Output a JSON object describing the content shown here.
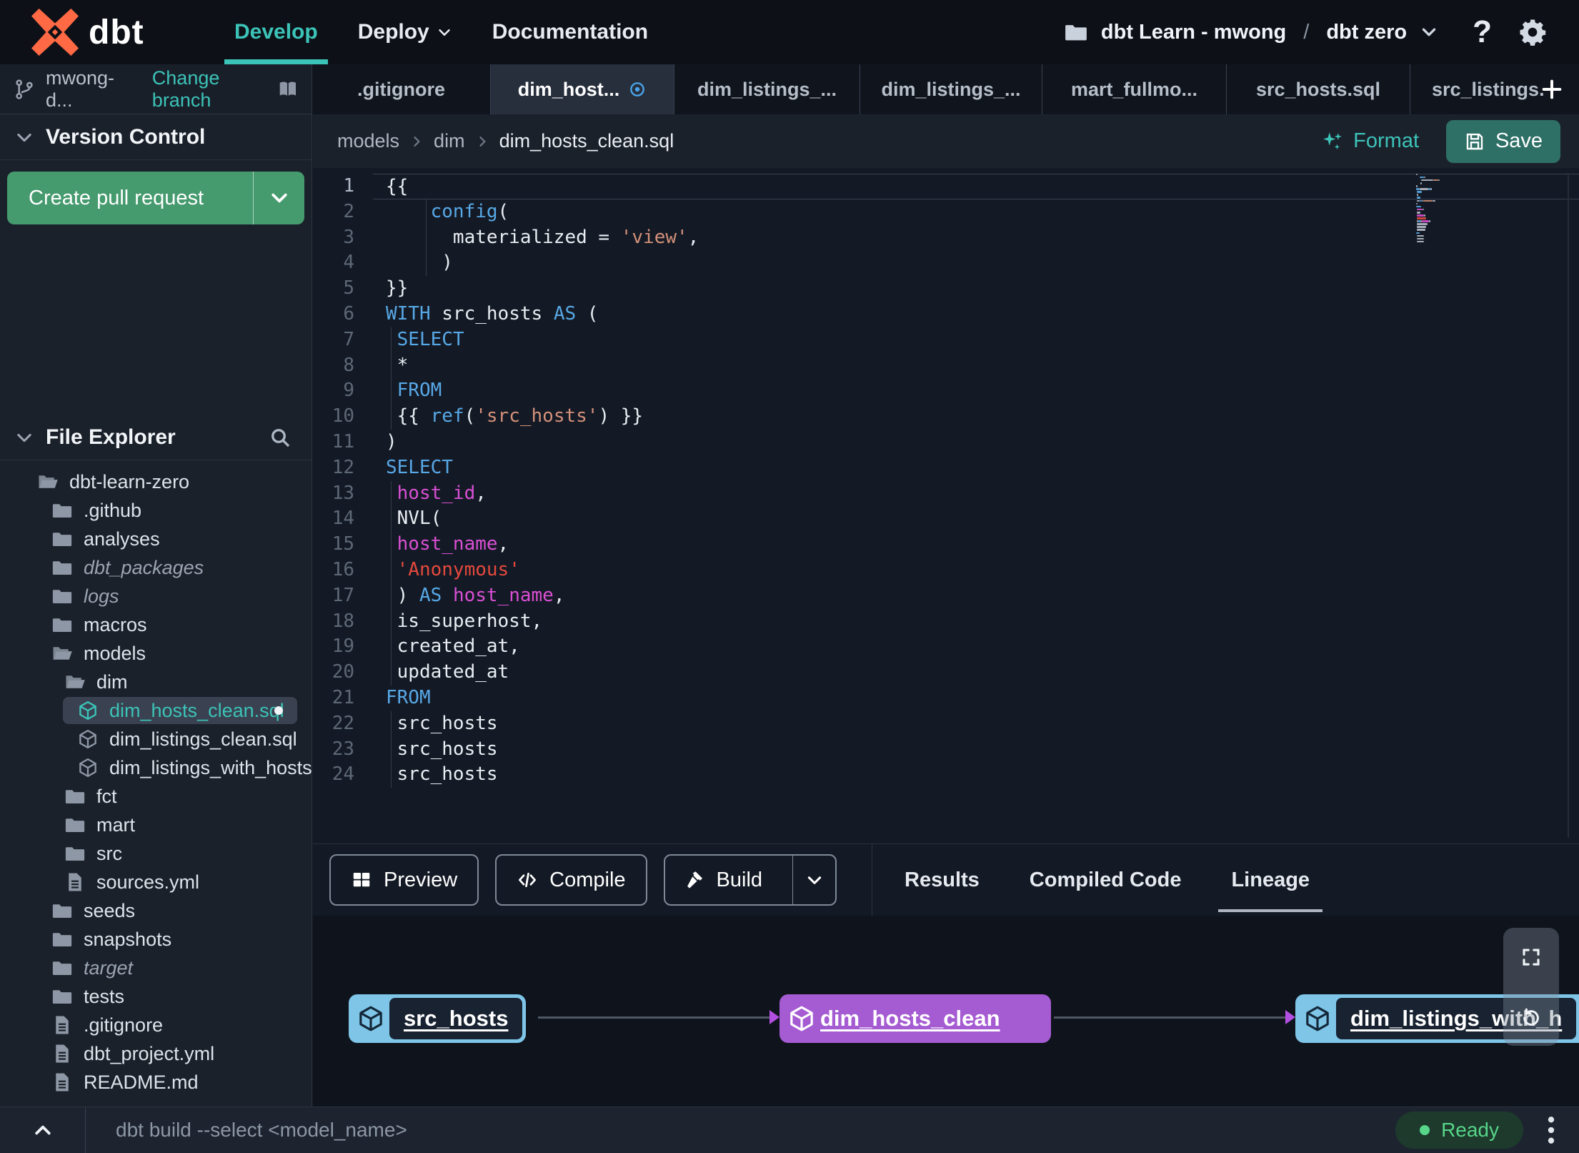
{
  "topbar": {
    "brand": "dbt",
    "nav": [
      {
        "label": "Develop",
        "active": true
      },
      {
        "label": "Deploy",
        "has_chevron": true
      },
      {
        "label": "Documentation"
      }
    ],
    "project_selector": {
      "account": "dbt Learn - mwong",
      "separator": "/",
      "project": "dbt zero"
    },
    "help_label": "?"
  },
  "branch_bar": {
    "branch": "mwong-d...",
    "change_branch": "Change branch"
  },
  "editor_tabs": [
    {
      "label": ".gitignore"
    },
    {
      "label": "dim_host...",
      "active": true,
      "modified": true
    },
    {
      "label": "dim_listings_..."
    },
    {
      "label": "dim_listings_..."
    },
    {
      "label": "mart_fullmo..."
    },
    {
      "label": "src_hosts.sql"
    },
    {
      "label": "src_listings.",
      "last": true
    }
  ],
  "sidebar": {
    "version_control": {
      "title": "Version Control",
      "create_pr": "Create pull request"
    },
    "file_explorer": {
      "title": "File Explorer",
      "items": [
        {
          "label": "dbt-learn-zero",
          "icon": "folder-open",
          "indent": 0
        },
        {
          "label": ".github",
          "icon": "folder",
          "indent": 1
        },
        {
          "label": "analyses",
          "icon": "folder",
          "indent": 1
        },
        {
          "label": "dbt_packages",
          "icon": "folder",
          "indent": 1,
          "italic": true
        },
        {
          "label": "logs",
          "icon": "folder",
          "indent": 1,
          "italic": true
        },
        {
          "label": "macros",
          "icon": "folder",
          "indent": 1
        },
        {
          "label": "models",
          "icon": "folder-open",
          "indent": 1
        },
        {
          "label": "dim",
          "icon": "folder-open",
          "indent": 2
        },
        {
          "label": "dim_hosts_clean.sql",
          "icon": "model",
          "indent": 3,
          "selected": true,
          "modified": true
        },
        {
          "label": "dim_listings_clean.sql",
          "icon": "model",
          "indent": 3
        },
        {
          "label": "dim_listings_with_hosts...",
          "icon": "model",
          "indent": 3
        },
        {
          "label": "fct",
          "icon": "folder",
          "indent": 2
        },
        {
          "label": "mart",
          "icon": "folder",
          "indent": 2
        },
        {
          "label": "src",
          "icon": "folder",
          "indent": 2
        },
        {
          "label": "sources.yml",
          "icon": "file",
          "indent": 2
        },
        {
          "label": "seeds",
          "icon": "folder",
          "indent": 1
        },
        {
          "label": "snapshots",
          "icon": "folder",
          "indent": 1
        },
        {
          "label": "target",
          "icon": "folder",
          "indent": 1,
          "italic": true
        },
        {
          "label": "tests",
          "icon": "folder",
          "indent": 1
        },
        {
          "label": ".gitignore",
          "icon": "file",
          "indent": 1
        },
        {
          "label": "dbt_project.yml",
          "icon": "file",
          "indent": 1
        },
        {
          "label": "README.md",
          "icon": "file",
          "indent": 1
        }
      ]
    }
  },
  "editor": {
    "breadcrumb": [
      "models",
      "dim",
      "dim_hosts_clean.sql"
    ],
    "format_label": "Format",
    "save_label": "Save",
    "code_lines": [
      {
        "n": 1,
        "cur": true,
        "segs": [
          [
            "{{",
            "p"
          ]
        ]
      },
      {
        "n": 2,
        "g": [
          3.6
        ],
        "segs": [
          [
            "    ",
            "p"
          ],
          [
            "config",
            "kw"
          ],
          [
            "(",
            "p"
          ]
        ]
      },
      {
        "n": 3,
        "g": [
          3.6
        ],
        "segs": [
          [
            "      materialized = ",
            "p"
          ],
          [
            "'view'",
            "str"
          ],
          [
            ",",
            "p"
          ]
        ]
      },
      {
        "n": 4,
        "g": [
          3.6
        ],
        "segs": [
          [
            "     )",
            "p"
          ]
        ]
      },
      {
        "n": 5,
        "segs": [
          [
            "}}",
            "p"
          ]
        ]
      },
      {
        "n": 6,
        "segs": [
          [
            "WITH",
            "kw"
          ],
          [
            " src_hosts ",
            "p"
          ],
          [
            "AS",
            "kw"
          ],
          [
            " (",
            "p"
          ]
        ]
      },
      {
        "n": 7,
        "g": [
          0.45
        ],
        "segs": [
          [
            " ",
            "p"
          ],
          [
            "SELECT",
            "kw"
          ]
        ]
      },
      {
        "n": 8,
        "g": [
          0.45
        ],
        "segs": [
          [
            " *",
            "p"
          ]
        ]
      },
      {
        "n": 9,
        "g": [
          0.45
        ],
        "segs": [
          [
            " ",
            "p"
          ],
          [
            "FROM",
            "kw"
          ]
        ]
      },
      {
        "n": 10,
        "g": [
          0.45
        ],
        "segs": [
          [
            " {{ ",
            "p"
          ],
          [
            "ref",
            "kw"
          ],
          [
            "(",
            "p"
          ],
          [
            "'src_hosts'",
            "str"
          ],
          [
            ") }}",
            "p"
          ]
        ]
      },
      {
        "n": 11,
        "segs": [
          [
            ")",
            "p"
          ]
        ]
      },
      {
        "n": 12,
        "segs": [
          [
            "SELECT",
            "kw"
          ]
        ]
      },
      {
        "n": 13,
        "g": [
          0.45
        ],
        "segs": [
          [
            " ",
            "p"
          ],
          [
            "host_id",
            "id"
          ],
          [
            ",",
            "p"
          ]
        ]
      },
      {
        "n": 14,
        "g": [
          0.45
        ],
        "segs": [
          [
            " NVL(",
            "p"
          ]
        ]
      },
      {
        "n": 15,
        "g": [
          0.45
        ],
        "segs": [
          [
            " ",
            "p"
          ],
          [
            "host_name",
            "id"
          ],
          [
            ",",
            "p"
          ]
        ]
      },
      {
        "n": 16,
        "g": [
          0.45
        ],
        "segs": [
          [
            " ",
            "p"
          ],
          [
            "'Anonymous'",
            "str2"
          ]
        ]
      },
      {
        "n": 17,
        "g": [
          0.45
        ],
        "segs": [
          [
            " ) ",
            "p"
          ],
          [
            "AS",
            "kw"
          ],
          [
            " ",
            "p"
          ],
          [
            "host_name",
            "id"
          ],
          [
            ",",
            "p"
          ]
        ]
      },
      {
        "n": 18,
        "g": [
          0.45
        ],
        "segs": [
          [
            " is_superhost,",
            "p"
          ]
        ]
      },
      {
        "n": 19,
        "g": [
          0.45
        ],
        "segs": [
          [
            " created_at,",
            "p"
          ]
        ]
      },
      {
        "n": 20,
        "g": [
          0.45
        ],
        "segs": [
          [
            " updated_at",
            "p"
          ]
        ]
      },
      {
        "n": 21,
        "segs": [
          [
            "FROM",
            "kw"
          ]
        ]
      },
      {
        "n": 22,
        "g": [
          0.45
        ],
        "segs": [
          [
            " src_hosts",
            "p"
          ]
        ]
      },
      {
        "n": 23,
        "g": [
          0.45
        ],
        "segs": [
          [
            " src_hosts",
            "p"
          ]
        ]
      },
      {
        "n": 24,
        "g": [
          0.45
        ],
        "segs": [
          [
            " src_hosts",
            "p"
          ]
        ]
      }
    ]
  },
  "bottom_panel": {
    "buttons": [
      {
        "label": "Preview",
        "icon": "grid-icon"
      },
      {
        "label": "Compile",
        "icon": "code-icon"
      },
      {
        "label": "Build",
        "icon": "hammer-icon",
        "split": true
      }
    ],
    "tabs": [
      {
        "label": "Results"
      },
      {
        "label": "Compiled Code"
      },
      {
        "label": "Lineage",
        "active": true
      }
    ]
  },
  "lineage": {
    "nodes": [
      {
        "label": "src_hosts",
        "color": "blue"
      },
      {
        "label": "dim_hosts_clean",
        "color": "purple"
      },
      {
        "label": "dim_listings_with_h",
        "color": "blue",
        "clipped": true
      }
    ]
  },
  "command_bar": {
    "placeholder": "dbt build --select <model_name>",
    "status": "Ready"
  },
  "colors": {
    "accent_teal": "#3cc3b8",
    "button_green": "#459a6e",
    "save_teal": "#2e6f66",
    "node_blue": "#7fc5e8",
    "node_purple": "#a55bd2",
    "modified_blue": "#4aa3e8",
    "ready_green": "#57d589",
    "logo_orange": "#ff6944",
    "keyword_blue": "#57a8e6",
    "string_salmon": "#d3907a",
    "string_red": "#e5493d",
    "identifier_magenta": "#d94fd4"
  }
}
